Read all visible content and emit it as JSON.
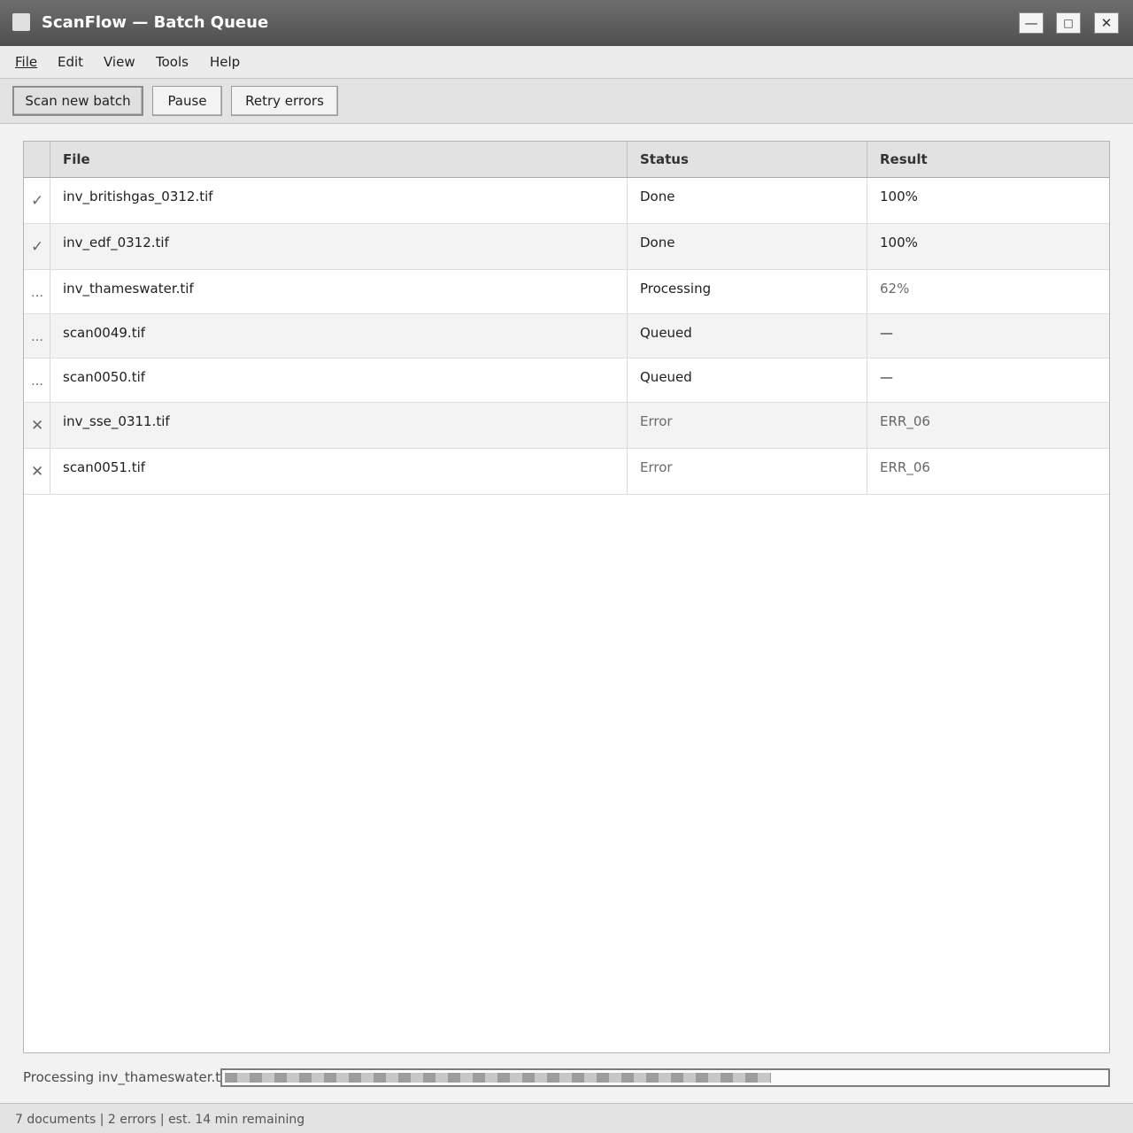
{
  "window": {
    "title": "ScanFlow — Batch Queue",
    "minimize_glyph": "—",
    "maximize_glyph": "□",
    "close_glyph": "✕"
  },
  "menu": [
    "File",
    "Edit",
    "View",
    "Tools",
    "Help"
  ],
  "toolbar": {
    "scan_new_batch": "Scan new batch",
    "pause": "Pause",
    "retry_errors": "Retry errors"
  },
  "table": {
    "columns": [
      "",
      "File",
      "Status",
      "Result"
    ],
    "rows": [
      {
        "icon": "check-icon",
        "glyph": "✓",
        "file": "inv_britishgas_0312.tif",
        "status": "Done",
        "result": "100%"
      },
      {
        "icon": "check-icon",
        "glyph": "✓",
        "file": "inv_edf_0312.tif",
        "status": "Done",
        "result": "100%"
      },
      {
        "icon": "pending-icon",
        "glyph": "…",
        "file": "inv_thameswater.tif",
        "status": "Processing",
        "result": "62%"
      },
      {
        "icon": "pending-icon",
        "glyph": "…",
        "file": "scan0049.tif",
        "status": "Queued",
        "result": "—"
      },
      {
        "icon": "pending-icon",
        "glyph": "…",
        "file": "scan0050.tif",
        "status": "Queued",
        "result": "—"
      },
      {
        "icon": "error-icon",
        "glyph": "✕",
        "file": "inv_sse_0311.tif",
        "status": "Error",
        "result": "ERR_06"
      },
      {
        "icon": "error-icon",
        "glyph": "✕",
        "file": "scan0051.tif",
        "status": "Error",
        "result": "ERR_06"
      }
    ]
  },
  "progress": {
    "label": "Processing inv_thameswater.tif",
    "fraction": 0.62
  },
  "statusbar": {
    "text": "7 documents | 2 errors | est. 14 min remaining"
  }
}
